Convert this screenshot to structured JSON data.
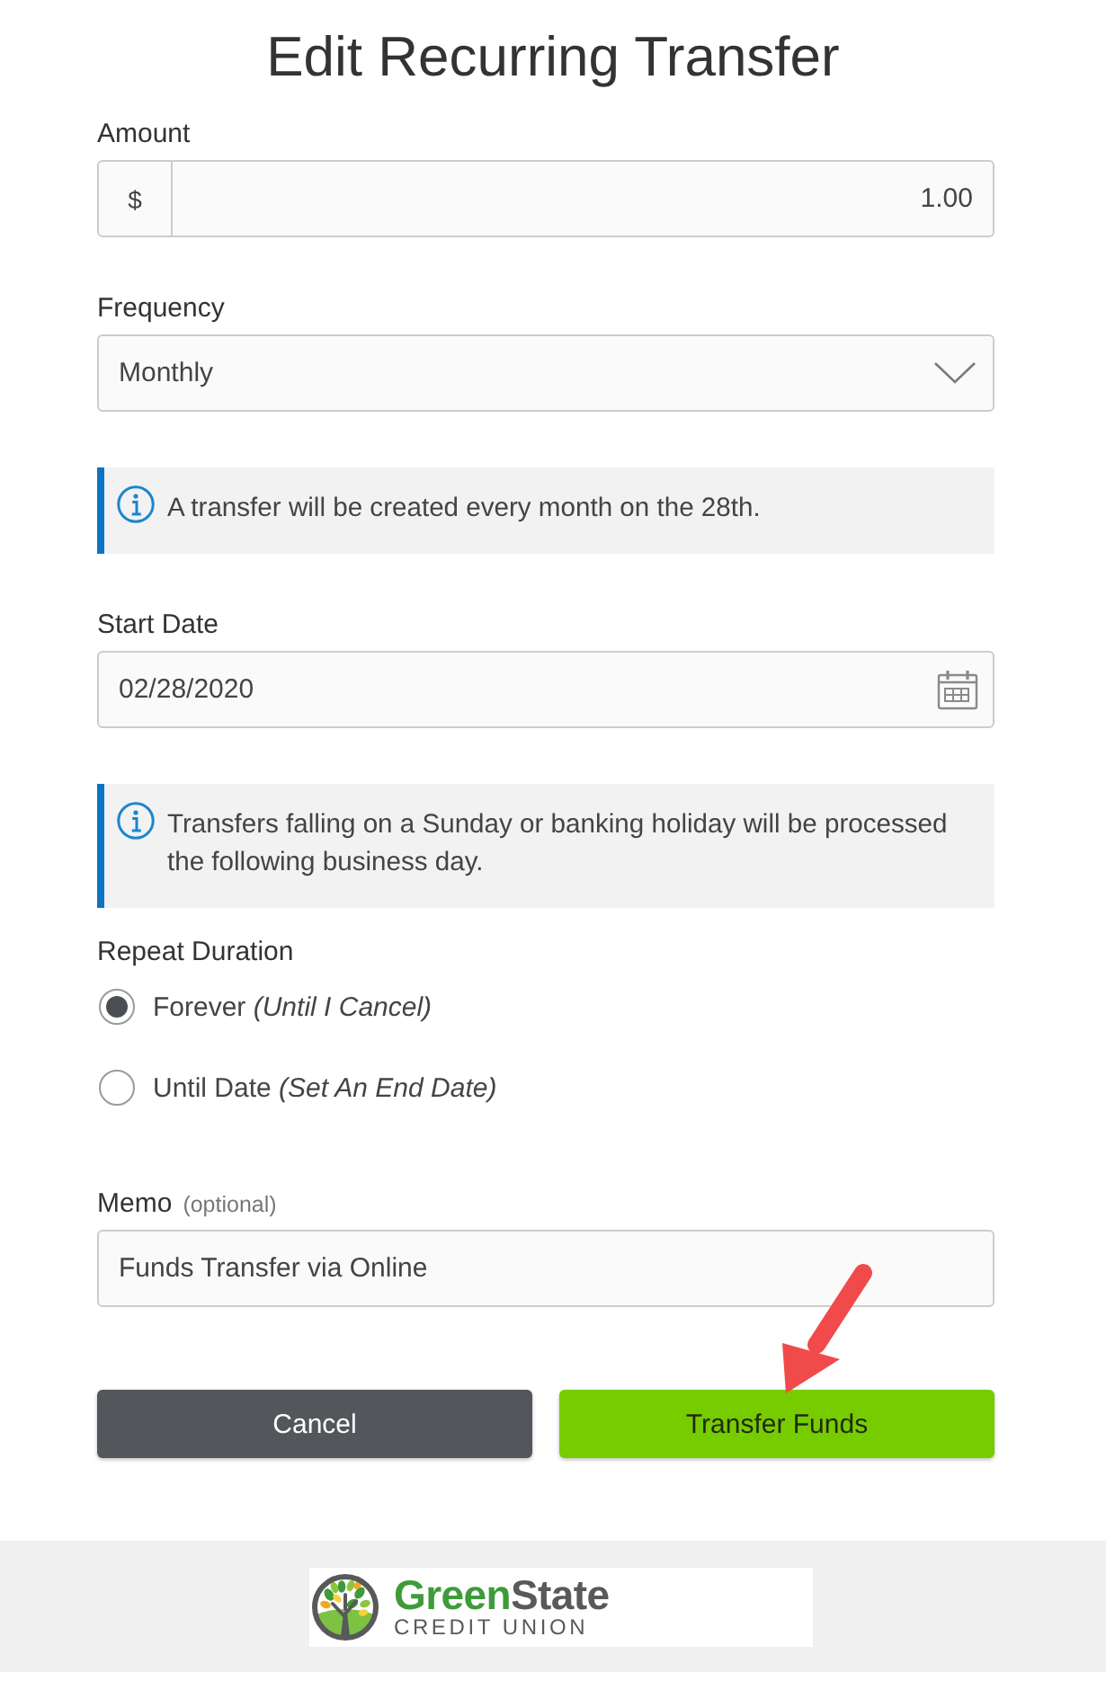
{
  "title": "Edit Recurring Transfer",
  "form": [
    {
      "kind": "amount",
      "label": "Amount",
      "prefix": "$",
      "value": "1.00"
    },
    {
      "kind": "select",
      "label": "Frequency",
      "value": "Monthly"
    },
    {
      "kind": "notice",
      "text": "A transfer will be created every month on the 28th."
    },
    {
      "kind": "date",
      "label": "Start Date",
      "value": "02/28/2020"
    },
    {
      "kind": "notice",
      "text": "Transfers falling on a Sunday or banking holiday will be processed the following business day."
    },
    {
      "kind": "radio_group",
      "label": "Repeat Duration",
      "options": [
        {
          "label": "Forever *(Until I Cancel)*",
          "selected": true
        },
        {
          "label": "Until Date *(Set An End Date)*",
          "selected": false
        }
      ]
    },
    {
      "kind": "text",
      "label": "Memo",
      "hint": "(optional)",
      "value": "Funds Transfer via Online"
    }
  ],
  "buttons": [
    {
      "kind": "secondary",
      "label": "Cancel"
    },
    {
      "kind": "primary",
      "label": "Transfer Funds"
    }
  ],
  "footer": {
    "logo": {
      "wordmark": [
        "Green",
        "State"
      ],
      "tagline": "CREDIT UNION"
    }
  }
}
